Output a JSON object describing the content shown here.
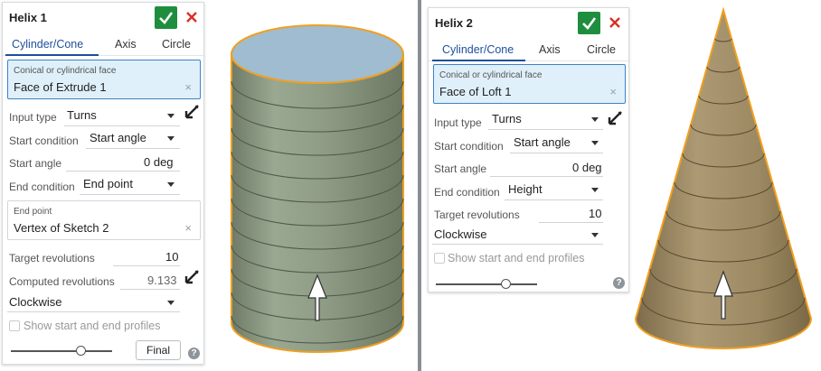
{
  "helix1": {
    "title": "Helix 1",
    "tabs": [
      "Cylinder/Cone",
      "Axis",
      "Circle"
    ],
    "face_label": "Conical or cylindrical face",
    "face_value": "Face of Extrude 1",
    "input_type_label": "Input type",
    "input_type_value": "Turns",
    "start_condition_label": "Start condition",
    "start_condition_value": "Start angle",
    "start_angle_label": "Start angle",
    "start_angle_value": "0 deg",
    "end_condition_label": "End condition",
    "end_condition_value": "End point",
    "end_point_label": "End point",
    "end_point_value": "Vertex of Sketch 2",
    "target_rev_label": "Target revolutions",
    "target_rev_value": "10",
    "computed_rev_label": "Computed revolutions",
    "computed_rev_value": "9.133",
    "direction_value": "Clockwise",
    "show_profiles_label": "Show start and end profiles",
    "final_label": "Final",
    "help_glyph": "?",
    "clear_glyph": "×"
  },
  "helix2": {
    "title": "Helix 2",
    "tabs": [
      "Cylinder/Cone",
      "Axis",
      "Circle"
    ],
    "face_label": "Conical or cylindrical face",
    "face_value": "Face of Loft 1",
    "input_type_label": "Input type",
    "input_type_value": "Turns",
    "start_condition_label": "Start condition",
    "start_condition_value": "Start angle",
    "start_angle_label": "Start angle",
    "start_angle_value": "0 deg",
    "end_condition_label": "End condition",
    "end_condition_value": "Height",
    "target_rev_label": "Target revolutions",
    "target_rev_value": "10",
    "direction_value": "Clockwise",
    "show_profiles_label": "Show start and end profiles",
    "help_glyph": "?",
    "clear_glyph": "×"
  },
  "colors": {
    "accept_green": "#1e8e3e",
    "cancel_red": "#d93025",
    "tab_active_blue": "#1d4f9c",
    "selection_fill": "#dff0fa",
    "cylinder_body": "#8f9c86",
    "cylinder_top": "#9fbcd1",
    "cone_body": "#a38f6a",
    "highlight_orange": "#f0a020"
  },
  "icons": [
    "check-icon",
    "close-icon",
    "flip-direction-icon",
    "help-icon",
    "clear-icon",
    "caret-down-icon"
  ]
}
